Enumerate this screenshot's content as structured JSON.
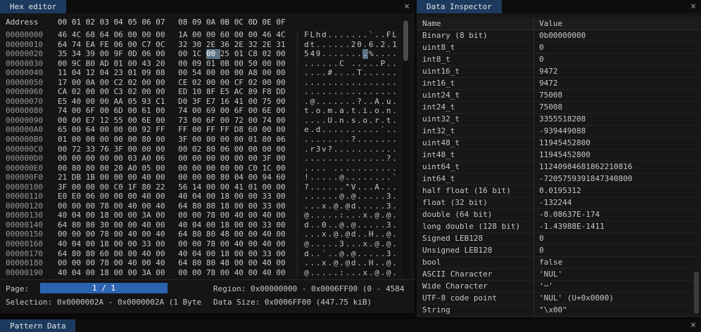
{
  "colors": {
    "tab_active": "#1c3a5e",
    "progress_fill": "#2d64b2",
    "selection_highlight": "#5b7384"
  },
  "hex_editor": {
    "title": "Hex editor",
    "close_icon": "×",
    "header": {
      "address_label": "Address",
      "byte_columns": [
        "00",
        "01",
        "02",
        "03",
        "04",
        "05",
        "06",
        "07",
        "08",
        "09",
        "0A",
        "0B",
        "0C",
        "0D",
        "0E",
        "0F"
      ]
    },
    "selection": {
      "row_index": 2,
      "byte_index": 10
    },
    "rows": [
      {
        "address": "00000000",
        "bytes": [
          "46",
          "4C",
          "68",
          "64",
          "06",
          "00",
          "00",
          "00",
          "1A",
          "00",
          "00",
          "60",
          "00",
          "00",
          "46",
          "4C"
        ],
        "ascii": "FLhd.......`..FL"
      },
      {
        "address": "00000010",
        "bytes": [
          "64",
          "74",
          "EA",
          "FE",
          "06",
          "00",
          "C7",
          "0C",
          "32",
          "30",
          "2E",
          "36",
          "2E",
          "32",
          "2E",
          "31"
        ],
        "ascii": "dt......20.6.2.1"
      },
      {
        "address": "00000020",
        "bytes": [
          "35",
          "34",
          "39",
          "00",
          "9F",
          "0D",
          "06",
          "00",
          "00",
          "1C",
          "00",
          "25",
          "01",
          "C8",
          "02",
          "00"
        ],
        "ascii": "549........%...."
      },
      {
        "address": "00000030",
        "bytes": [
          "00",
          "9C",
          "B0",
          "AD",
          "01",
          "00",
          "43",
          "20",
          "00",
          "09",
          "01",
          "0B",
          "00",
          "50",
          "00",
          "00"
        ],
        "ascii": "......C .....P.."
      },
      {
        "address": "00000040",
        "bytes": [
          "11",
          "04",
          "12",
          "04",
          "23",
          "01",
          "09",
          "08",
          "00",
          "54",
          "00",
          "00",
          "00",
          "A8",
          "00",
          "00"
        ],
        "ascii": "....#....T......"
      },
      {
        "address": "00000050",
        "bytes": [
          "17",
          "00",
          "0A",
          "00",
          "C2",
          "02",
          "00",
          "00",
          "CE",
          "02",
          "00",
          "00",
          "CF",
          "02",
          "00",
          "00"
        ],
        "ascii": "................"
      },
      {
        "address": "00000060",
        "bytes": [
          "CA",
          "02",
          "00",
          "00",
          "C3",
          "02",
          "00",
          "00",
          "ED",
          "10",
          "8F",
          "E5",
          "AC",
          "89",
          "F8",
          "DD"
        ],
        "ascii": "................"
      },
      {
        "address": "00000070",
        "bytes": [
          "E5",
          "40",
          "00",
          "00",
          "AA",
          "05",
          "93",
          "C1",
          "D0",
          "3F",
          "E7",
          "16",
          "41",
          "00",
          "75",
          "00"
        ],
        "ascii": ".@.......?..A.u."
      },
      {
        "address": "00000080",
        "bytes": [
          "74",
          "00",
          "6F",
          "00",
          "6D",
          "00",
          "61",
          "00",
          "74",
          "00",
          "69",
          "00",
          "6F",
          "00",
          "6E",
          "00"
        ],
        "ascii": "t.o.m.a.t.i.o.n."
      },
      {
        "address": "00000090",
        "bytes": [
          "00",
          "00",
          "E7",
          "12",
          "55",
          "00",
          "6E",
          "00",
          "73",
          "00",
          "6F",
          "00",
          "72",
          "00",
          "74",
          "00"
        ],
        "ascii": "....U.n.s.o.r.t."
      },
      {
        "address": "000000A0",
        "bytes": [
          "65",
          "00",
          "64",
          "00",
          "00",
          "00",
          "92",
          "FF",
          "FF",
          "00",
          "FF",
          "FF",
          "D8",
          "60",
          "00",
          "00"
        ],
        "ascii": "e.d..........`.."
      },
      {
        "address": "000000B0",
        "bytes": [
          "01",
          "00",
          "00",
          "00",
          "00",
          "00",
          "80",
          "00",
          "3F",
          "00",
          "00",
          "00",
          "00",
          "01",
          "80",
          "06"
        ],
        "ascii": "........?......."
      },
      {
        "address": "000000C0",
        "bytes": [
          "00",
          "72",
          "33",
          "76",
          "3F",
          "00",
          "00",
          "00",
          "00",
          "02",
          "80",
          "06",
          "00",
          "00",
          "00",
          "00"
        ],
        "ascii": ".r3v?..........."
      },
      {
        "address": "000000D0",
        "bytes": [
          "00",
          "00",
          "00",
          "00",
          "00",
          "03",
          "A0",
          "06",
          "00",
          "00",
          "00",
          "00",
          "00",
          "00",
          "3F",
          "00"
        ],
        "ascii": "..............?."
      },
      {
        "address": "000000E0",
        "bytes": [
          "00",
          "80",
          "80",
          "00",
          "20",
          "A0",
          "05",
          "00",
          "00",
          "00",
          "00",
          "00",
          "00",
          "C0",
          "1C",
          "00"
        ],
        "ascii": ".... ..........."
      },
      {
        "address": "000000F0",
        "bytes": [
          "21",
          "DB",
          "1B",
          "00",
          "00",
          "00",
          "40",
          "00",
          "00",
          "00",
          "00",
          "80",
          "04",
          "00",
          "94",
          "60"
        ],
        "ascii": "!.....@........`"
      },
      {
        "address": "00000100",
        "bytes": [
          "3F",
          "00",
          "00",
          "00",
          "C0",
          "1F",
          "80",
          "22",
          "56",
          "14",
          "00",
          "00",
          "41",
          "01",
          "00",
          "00"
        ],
        "ascii": "?......\"V...A..."
      },
      {
        "address": "00000110",
        "bytes": [
          "E0",
          "E0",
          "06",
          "00",
          "00",
          "00",
          "40",
          "00",
          "40",
          "04",
          "00",
          "18",
          "00",
          "00",
          "33",
          "00"
        ],
        "ascii": "......@.@.....3."
      },
      {
        "address": "00000120",
        "bytes": [
          "00",
          "00",
          "00",
          "78",
          "00",
          "40",
          "00",
          "40",
          "64",
          "80",
          "80",
          "18",
          "00",
          "00",
          "33",
          "00"
        ],
        "ascii": "...x.@.@d.....3."
      },
      {
        "address": "00000130",
        "bytes": [
          "40",
          "04",
          "00",
          "18",
          "00",
          "00",
          "3A",
          "00",
          "00",
          "00",
          "78",
          "00",
          "40",
          "00",
          "40",
          "00"
        ],
        "ascii": "@.....:...x.@.@."
      },
      {
        "address": "00000140",
        "bytes": [
          "64",
          "80",
          "80",
          "30",
          "00",
          "00",
          "40",
          "00",
          "40",
          "04",
          "00",
          "18",
          "00",
          "00",
          "33",
          "00"
        ],
        "ascii": "d..0..@.@.....3."
      },
      {
        "address": "00000150",
        "bytes": [
          "00",
          "00",
          "00",
          "78",
          "00",
          "40",
          "00",
          "40",
          "64",
          "80",
          "80",
          "48",
          "00",
          "00",
          "40",
          "00"
        ],
        "ascii": "...x.@.@d..H..@."
      },
      {
        "address": "00000160",
        "bytes": [
          "40",
          "04",
          "00",
          "18",
          "00",
          "00",
          "33",
          "00",
          "00",
          "00",
          "78",
          "00",
          "40",
          "00",
          "40",
          "00"
        ],
        "ascii": "@.....3...x.@.@."
      },
      {
        "address": "00000170",
        "bytes": [
          "64",
          "80",
          "80",
          "60",
          "00",
          "00",
          "40",
          "00",
          "40",
          "04",
          "00",
          "18",
          "00",
          "00",
          "33",
          "00"
        ],
        "ascii": "d..`..@.@.....3."
      },
      {
        "address": "00000180",
        "bytes": [
          "00",
          "00",
          "00",
          "78",
          "00",
          "40",
          "00",
          "40",
          "64",
          "80",
          "80",
          "48",
          "00",
          "00",
          "40",
          "00"
        ],
        "ascii": "...x.@.@d..H..@."
      },
      {
        "address": "00000190",
        "bytes": [
          "40",
          "04",
          "00",
          "18",
          "00",
          "00",
          "3A",
          "00",
          "00",
          "00",
          "78",
          "00",
          "40",
          "00",
          "40",
          "00"
        ],
        "ascii": "@.....:...x.@.@."
      }
    ],
    "footer": {
      "page_label": "Page:",
      "page_value": "1 / 1",
      "region": "Region: 0x00000000 - 0x0006FF00 (0 - 4584",
      "selection": "Selection: 0x0000002A - 0x0000002A (1 Byte",
      "data_size": "Data Size: 0x0006FF00 (447.75 kiB)"
    }
  },
  "data_inspector": {
    "title": "Data Inspector",
    "close_icon": "×",
    "columns": [
      "Name",
      "Value"
    ],
    "rows": [
      {
        "name": "Binary (8 bit)",
        "value": "0b00000000"
      },
      {
        "name": "uint8_t",
        "value": "0"
      },
      {
        "name": "int8_t",
        "value": "0"
      },
      {
        "name": "uint16_t",
        "value": "9472"
      },
      {
        "name": "int16_t",
        "value": "9472"
      },
      {
        "name": "uint24_t",
        "value": "75008"
      },
      {
        "name": "int24_t",
        "value": "75008"
      },
      {
        "name": "uint32_t",
        "value": "3355518208"
      },
      {
        "name": "int32_t",
        "value": "-939449088"
      },
      {
        "name": "uint48_t",
        "value": "11945452800"
      },
      {
        "name": "int48_t",
        "value": "11945452800"
      },
      {
        "name": "uint64_t",
        "value": "11240984681862210816"
      },
      {
        "name": "int64_t",
        "value": "-7205759391847340800"
      },
      {
        "name": "half float (16 bit)",
        "value": "0.0195312"
      },
      {
        "name": "float (32 bit)",
        "value": "-132244"
      },
      {
        "name": "double (64 bit)",
        "value": "-8.08637E-174"
      },
      {
        "name": "long double (128 bit)",
        "value": "-1.43988E-1411"
      },
      {
        "name": "Signed LEB128",
        "value": "0"
      },
      {
        "name": "Unsigned LEB128",
        "value": "0"
      },
      {
        "name": "bool",
        "value": "false"
      },
      {
        "name": "ASCII Character",
        "value": "'NUL'"
      },
      {
        "name": "Wide Character",
        "value": "'─'"
      },
      {
        "name": "UTF-8 code point",
        "value": "'NUL' (U+0x0000)"
      },
      {
        "name": "String",
        "value": "\"\\x00\""
      }
    ]
  },
  "pattern_data": {
    "title": "Pattern Data",
    "close_icon": "×"
  }
}
